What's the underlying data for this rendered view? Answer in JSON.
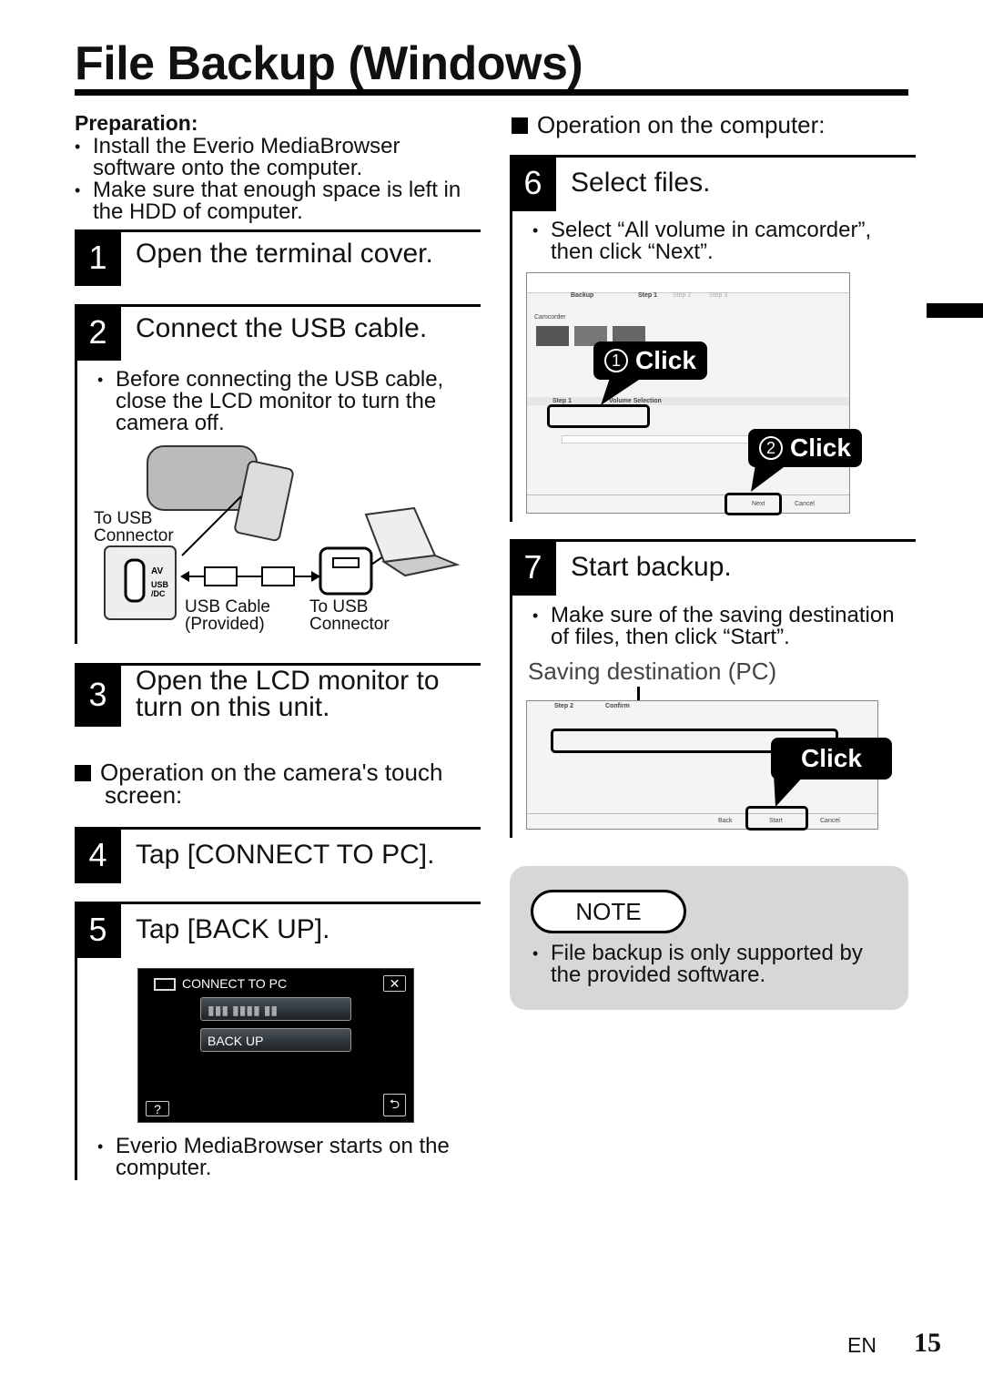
{
  "title": "File Backup (Windows)",
  "preparation": {
    "heading": "Preparation:",
    "items": [
      "Install the Everio MediaBrowser software onto the computer.",
      "Make sure that enough space is left in the HDD of computer."
    ]
  },
  "steps": [
    {
      "num": "1",
      "label": "Open the terminal cover."
    },
    {
      "num": "2",
      "label": "Connect the USB cable.",
      "bullets": [
        "Before connecting the USB cable, close the LCD monitor to turn the camera off."
      ],
      "diagram": {
        "to_usb_connector_camera": "To USB Connector",
        "usb_cable": "USB Cable (Provided)",
        "to_usb_connector_pc": "To USB Connector",
        "port_labels": [
          "AV",
          "USB /DC"
        ]
      }
    },
    {
      "num": "3",
      "label": "Open the LCD monitor to turn on this unit."
    },
    {
      "num": "4",
      "label": "Tap [CONNECT TO PC]."
    },
    {
      "num": "5",
      "label": "Tap [BACK UP].",
      "bullets": [
        "Everio MediaBrowser starts on the computer."
      ],
      "screen": {
        "title": "CONNECT TO PC",
        "button_obscured": "▮▮▮ ▮▮▮▮ ▮▮",
        "button_backup": "BACK UP",
        "help": "?",
        "close": "✕",
        "back": "⮌"
      }
    },
    {
      "num": "6",
      "label": "Select files.",
      "bullets": [
        "Select “All volume in camcorder”, then click “Next”."
      ],
      "screenshot": {
        "tab": "Backup",
        "steps": [
          "Step 1",
          "Step 2",
          "Step 3"
        ],
        "section": "Camcorder",
        "lower_step": "Step 1",
        "lower_title": "Volume Selection",
        "next": "Next",
        "cancel": "Cancel",
        "callout1": "Click",
        "callout2": "Click",
        "callout1_num": "1",
        "callout2_num": "2"
      }
    },
    {
      "num": "7",
      "label": "Start backup.",
      "bullets": [
        "Make sure of the saving destination of files, then click “Start”."
      ],
      "caption": "Saving destination (PC)",
      "screenshot": {
        "step": "Step 2",
        "title": "Confirm",
        "back": "Back",
        "start": "Start",
        "cancel": "Cancel",
        "callout": "Click"
      }
    }
  ],
  "camera_op": "Operation on the camera's touch screen:",
  "computer_op": "Operation on the computer:",
  "note": {
    "badge": "NOTE",
    "items": [
      "File backup is only supported by the provided software."
    ]
  },
  "footer": {
    "lang": "EN",
    "page": "15"
  }
}
